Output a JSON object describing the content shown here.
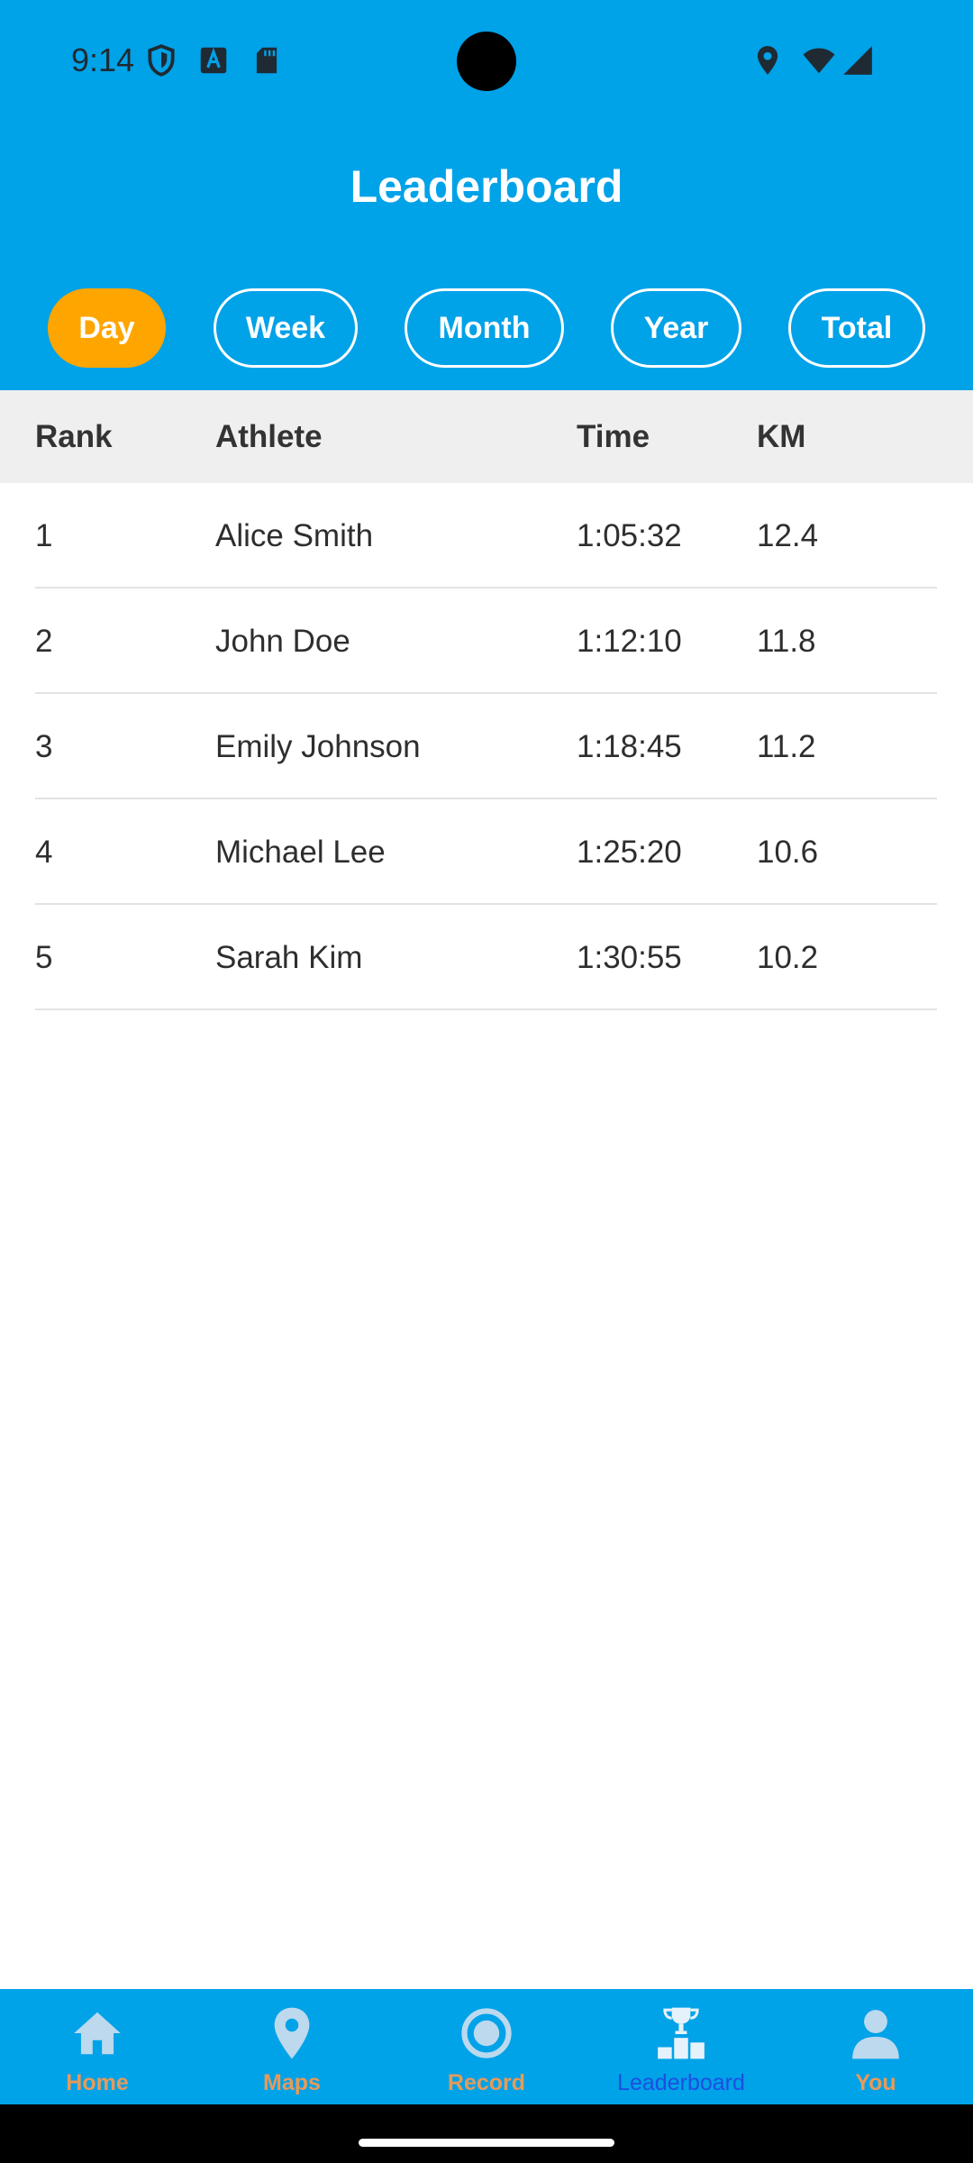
{
  "status_bar": {
    "time": "9:14",
    "icons": [
      "shield-icon",
      "font-a-icon",
      "sd-card-icon",
      "location-icon",
      "wifi-icon",
      "signal-icon"
    ]
  },
  "header": {
    "title": "Leaderboard",
    "background": "#00a2e8"
  },
  "filters": {
    "selected": "Day",
    "items": [
      {
        "label": "Day"
      },
      {
        "label": "Week"
      },
      {
        "label": "Month"
      },
      {
        "label": "Year"
      },
      {
        "label": "Total"
      }
    ],
    "active_color": "#ffa500"
  },
  "table": {
    "columns": [
      "Rank",
      "Athlete",
      "Time",
      "KM"
    ],
    "rows": [
      {
        "rank": "1",
        "athlete": "Alice Smith",
        "time": "1:05:32",
        "km": "12.4"
      },
      {
        "rank": "2",
        "athlete": "John Doe",
        "time": "1:12:10",
        "km": "11.8"
      },
      {
        "rank": "3",
        "athlete": "Emily Johnson",
        "time": "1:18:45",
        "km": "11.2"
      },
      {
        "rank": "4",
        "athlete": "Michael Lee",
        "time": "1:25:20",
        "km": "10.6"
      },
      {
        "rank": "5",
        "athlete": "Sarah Kim",
        "time": "1:30:55",
        "km": "10.2"
      }
    ]
  },
  "bottom_nav": {
    "active": "Leaderboard",
    "items": [
      {
        "label": "Home",
        "icon": "home-icon"
      },
      {
        "label": "Maps",
        "icon": "map-pin-icon"
      },
      {
        "label": "Record",
        "icon": "record-icon"
      },
      {
        "label": "Leaderboard",
        "icon": "podium-trophy-icon"
      },
      {
        "label": "You",
        "icon": "person-icon"
      }
    ]
  }
}
